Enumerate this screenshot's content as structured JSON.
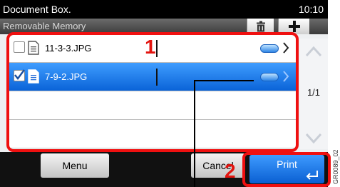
{
  "header": {
    "title": "Document Box.",
    "time": "10:10",
    "subtitle": "Removable Memory",
    "trash_icon": "trash-icon",
    "add_icon": "plus-icon"
  },
  "files": [
    {
      "name": "11-3-3.JPG",
      "checked": false
    },
    {
      "name": "7-9-2.JPG",
      "checked": true
    }
  ],
  "pager": {
    "page": "1/1"
  },
  "buttons": {
    "menu": "Menu",
    "cancel": "Cancel",
    "print": "Print"
  },
  "callouts": {
    "c1": "1",
    "c2": "2"
  },
  "figure_code": "GR0089_02",
  "colors": {
    "accent": "#1f7af0",
    "highlight": "#ef1010",
    "titlebar": "#000000"
  }
}
